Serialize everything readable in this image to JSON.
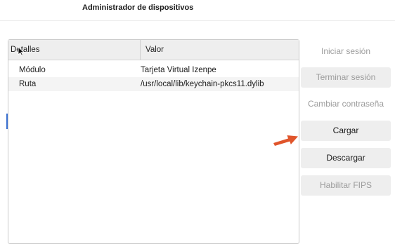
{
  "page_text_fragment": "",
  "window": {
    "title": "Administrador de dispositivos"
  },
  "table": {
    "columns": [
      "Detalles",
      "Valor"
    ],
    "rows": [
      {
        "label": "Módulo",
        "value": "Tarjeta Virtual Izenpe"
      },
      {
        "label": "Ruta",
        "value": "/usr/local/lib/keychain-pkcs11.dylib"
      }
    ]
  },
  "buttons": {
    "iniciar_sesion": "Iniciar sesión",
    "terminar_sesion": "Terminar sesión",
    "cambiar_contrasena": "Cambiar contraseña",
    "cargar": "Cargar",
    "descargar": "Descargar",
    "habilitar_fips": "Habilitar FIPS"
  },
  "colors": {
    "annotation_arrow": "#e0552b",
    "button_bg": "#eeeeee",
    "disabled_text": "#9c9c9c"
  }
}
